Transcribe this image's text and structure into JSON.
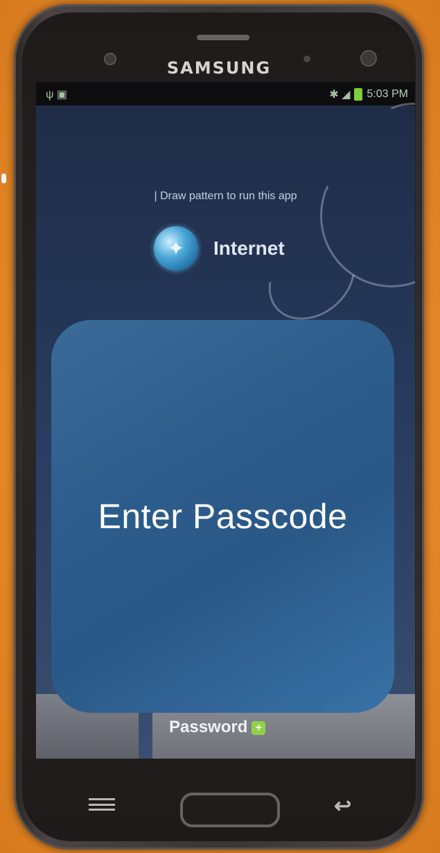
{
  "device": {
    "brand": "SAMSUNG",
    "body_color": "#3a3535",
    "background_color": "#e68a2a"
  },
  "status_bar": {
    "left_icons": "ψ ▣",
    "right_icons": "✱ ◢",
    "time": "5:03 PM"
  },
  "lock_screen": {
    "prompt": "| Draw pattern to run this app",
    "app_icon": "globe-icon",
    "app_name": "Internet",
    "password_label": "Password",
    "password_badge": "+"
  },
  "overlay": {
    "title": "Enter Passcode",
    "color": "#2d5d8c"
  },
  "nav_keys": {
    "menu_icon": "menu-icon",
    "home_icon": "home-button",
    "back_icon": "↩"
  }
}
